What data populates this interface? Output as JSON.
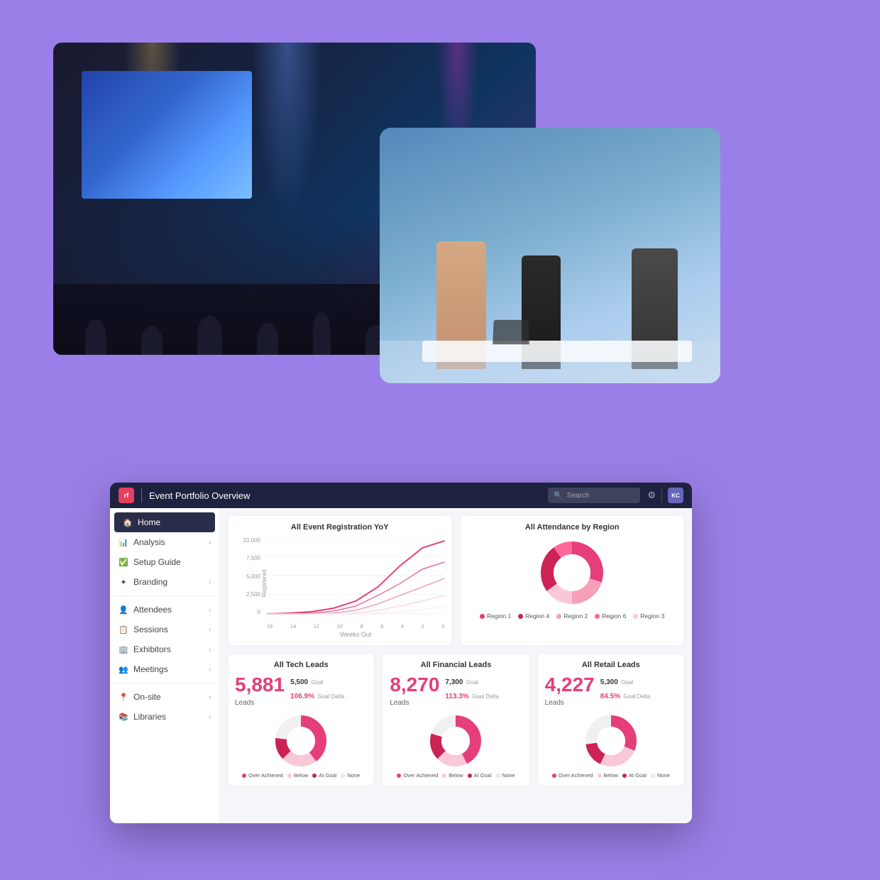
{
  "page": {
    "background_color": "#9b7fe8"
  },
  "topbar": {
    "logo_text": "rf",
    "title": "Event Portfolio Overview",
    "search_placeholder": "Search",
    "avatar_text": "KC"
  },
  "sidebar": {
    "items": [
      {
        "id": "home",
        "label": "Home",
        "icon": "🏠",
        "active": true,
        "has_chevron": false
      },
      {
        "id": "analysis",
        "label": "Analysis",
        "icon": "📊",
        "active": false,
        "has_chevron": true
      },
      {
        "id": "setup-guide",
        "label": "Setup Guide",
        "icon": "✅",
        "active": false,
        "has_chevron": false
      },
      {
        "id": "branding",
        "label": "Branding",
        "icon": "✦",
        "active": false,
        "has_chevron": true
      },
      {
        "id": "divider1",
        "label": "",
        "type": "divider"
      },
      {
        "id": "attendees",
        "label": "Attendees",
        "icon": "👤",
        "active": false,
        "has_chevron": true
      },
      {
        "id": "sessions",
        "label": "Sessions",
        "icon": "📋",
        "active": false,
        "has_chevron": true
      },
      {
        "id": "exhibitors",
        "label": "Exhibitors",
        "icon": "🏢",
        "active": false,
        "has_chevron": true
      },
      {
        "id": "meetings",
        "label": "Meetings",
        "icon": "👥",
        "active": false,
        "has_chevron": true
      },
      {
        "id": "divider2",
        "label": "",
        "type": "divider"
      },
      {
        "id": "on-site",
        "label": "On-site",
        "icon": "📍",
        "active": false,
        "has_chevron": true
      },
      {
        "id": "libraries",
        "label": "Libraries",
        "icon": "📚",
        "active": false,
        "has_chevron": true
      }
    ]
  },
  "registration_chart": {
    "title": "All Event Registration YoY",
    "y_axis_labels": [
      "10,000",
      "7,500",
      "5,000",
      "2,500",
      "0"
    ],
    "y_axis_title": "Registered",
    "x_axis_labels": [
      "16",
      "14",
      "12",
      "10",
      "8",
      "6",
      "4",
      "2",
      "0"
    ],
    "x_axis_title": "Weeks Out"
  },
  "attendance_chart": {
    "title": "All Attendance by Region",
    "legend": [
      {
        "label": "Region 1",
        "color": "#e53e7a"
      },
      {
        "label": "Region 2",
        "color": "#f5a0b8"
      },
      {
        "label": "Region 3",
        "color": "#f9c8d8"
      },
      {
        "label": "Region 4",
        "color": "#cc2255"
      },
      {
        "label": "Region 6",
        "color": "#ff6699"
      }
    ]
  },
  "tech_leads": {
    "title": "All Tech Leads",
    "value": "5,881",
    "label": "Leads",
    "goal": "5,500",
    "goal_label": "Goal",
    "goal_delta": "106.9%",
    "goal_delta_label": "Goal Delta",
    "legend": [
      {
        "label": "Over Achieved",
        "color": "#e53e7a"
      },
      {
        "label": "Below",
        "color": "#f5a0b8"
      },
      {
        "label": "At Goal",
        "color": "#cc2255"
      },
      {
        "label": "None",
        "color": "#f0f0f0"
      }
    ]
  },
  "financial_leads": {
    "title": "All Financial Leads",
    "value": "8,270",
    "label": "Leads",
    "goal": "7,300",
    "goal_label": "Goal",
    "goal_delta": "113.3%",
    "goal_delta_label": "Goal Delta",
    "legend": [
      {
        "label": "Over Achieved",
        "color": "#e53e7a"
      },
      {
        "label": "Below",
        "color": "#f5a0b8"
      },
      {
        "label": "At Goal",
        "color": "#cc2255"
      },
      {
        "label": "None",
        "color": "#f0f0f0"
      }
    ]
  },
  "retail_leads": {
    "title": "All Retail Leads",
    "value": "4,227",
    "label": "Leads",
    "goal": "5,300",
    "goal_label": "Goal",
    "goal_delta": "84.5%",
    "goal_delta_label": "Goal Delta",
    "legend": [
      {
        "label": "Over Achieved",
        "color": "#e53e7a"
      },
      {
        "label": "Below",
        "color": "#f5a0b8"
      },
      {
        "label": "At Goal",
        "color": "#cc2255"
      },
      {
        "label": "None",
        "color": "#f0f0f0"
      }
    ]
  }
}
